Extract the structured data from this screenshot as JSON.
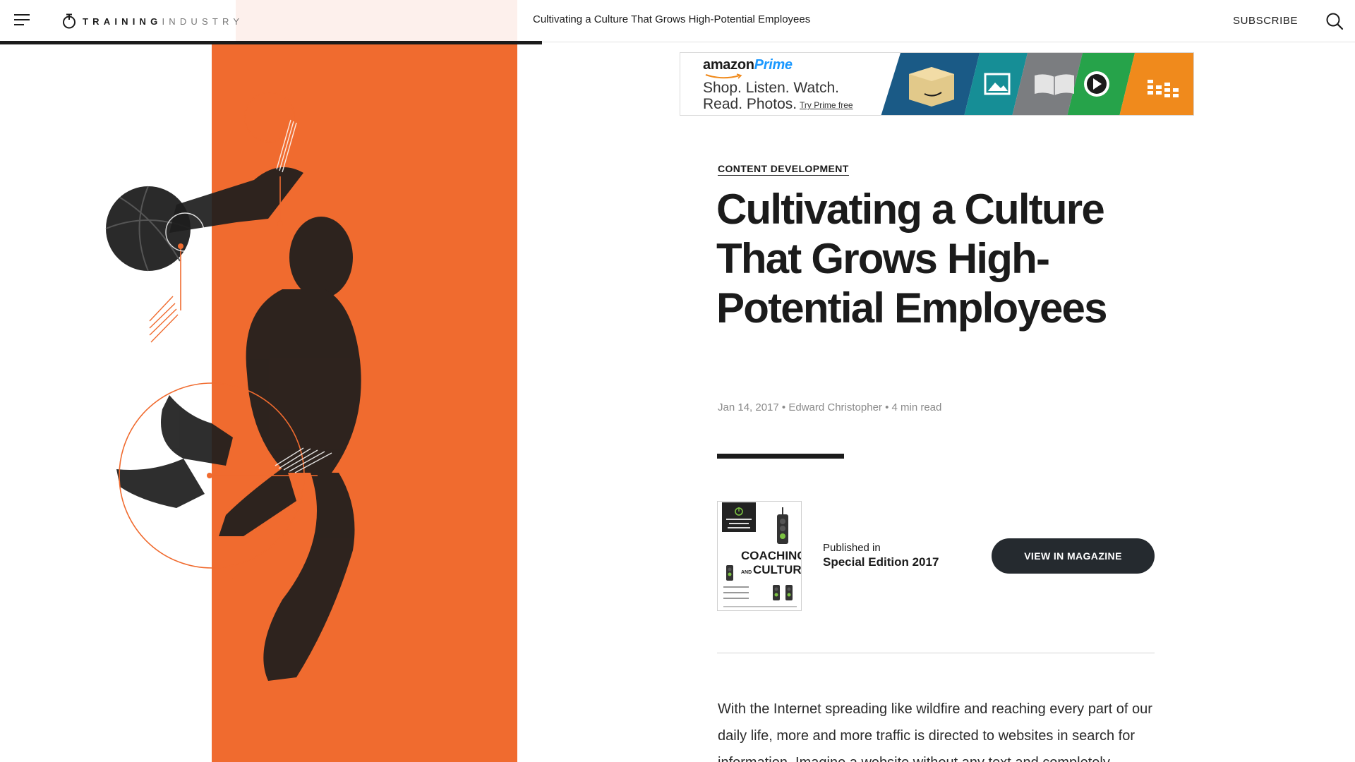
{
  "header": {
    "brand_bold": "TRAINING",
    "brand_light": "INDUSTRY",
    "article_title": "Cultivating a Culture That Grows High-Potential Employees",
    "subscribe_label": "SUBSCRIBE",
    "menu_icon": "hamburger-icon",
    "search_icon": "search-icon",
    "reading_progress": 0.4
  },
  "ad": {
    "brand": "amazon",
    "brand_accent": "Prime",
    "line1": "Shop. Listen. Watch.",
    "line2": "Read. Photos.",
    "cta": "Try Prime free",
    "tiles": [
      {
        "icon": "box-icon",
        "color": "#1a5a86"
      },
      {
        "icon": "photo-icon",
        "color": "#168e96"
      },
      {
        "icon": "book-icon",
        "color": "#7b7d80"
      },
      {
        "icon": "play-icon",
        "color": "#26a34a"
      },
      {
        "icon": "music-icon",
        "color": "#f08a1c"
      }
    ]
  },
  "article": {
    "category": "CONTENT DEVELOPMENT",
    "headline": "Cultivating a Culture That Grows High-Potential Employees",
    "date": "Jan 14, 2017",
    "author": "Edward Christopher",
    "read_time": "4 min read",
    "published_label": "Published in",
    "edition": "Special Edition 2017",
    "view_button": "VIEW IN MAGAZINE",
    "body_lead": "With the Internet spreading like wildfire and reaching every part of our daily life, more and more traffic is directed to websites in search for information. Imagine a website without any text and completely"
  },
  "magazine": {
    "title_line1": "COACHING",
    "title_and": "AND",
    "title_line2": "CULTURE"
  },
  "colors": {
    "accent_orange": "#f06b2f",
    "dark": "#1b1b1b",
    "button_bg": "#252a2f",
    "meta_gray": "#8a8a8a"
  }
}
